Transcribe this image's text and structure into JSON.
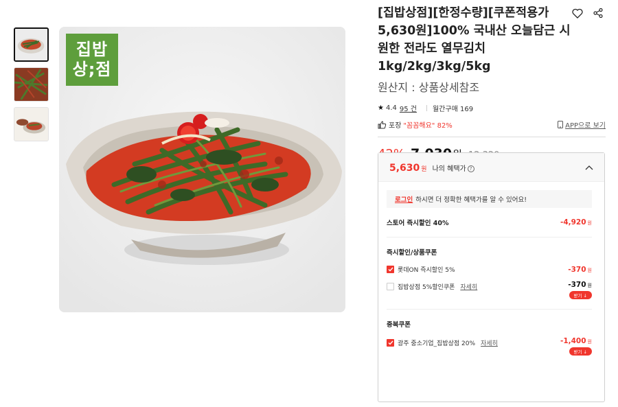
{
  "brand": {
    "logo_line1": "집밥",
    "logo_line2": "상;점",
    "color": "#5e9e3c"
  },
  "product": {
    "title": "[집밥상점][한정수량][쿠폰적용가 5,630원]100% 국내산 오늘담근 시원한 전라도 열무김치 1kg/2kg/3kg/5kg",
    "origin": "원산지 : 상품상세참조"
  },
  "icons": {
    "wishlist": "heart-icon",
    "share": "share-icon",
    "star": "star-icon",
    "thumbs": "thumbs-up-icon",
    "phone": "phone-icon"
  },
  "meta": {
    "rating": "4.4",
    "reviews": "95 건",
    "monthly": "월간구매 169"
  },
  "packaging": {
    "label": "포장",
    "quote": "\"꼼꼼해요\" 82%",
    "app_link": "APP으로 보기"
  },
  "price": {
    "discount": "42%",
    "sale": "7,030",
    "won": "원",
    "original": "12,320"
  },
  "benefit": {
    "price": "5,630",
    "won": "원",
    "label": "나의 혜택가",
    "login_link": "로그인",
    "login_text": "하시면 더 정확한 혜택가를 알 수 있어요!",
    "store_discount_label": "스토어 즉시할인 40%",
    "store_discount_amount": "-4,920",
    "section1_title": "즉시할인/상품쿠폰",
    "opt1_label": "롯데ON 즉시할인 5%",
    "opt1_amount": "-370",
    "opt2_label": "집밥상점 5%할인쿠폰",
    "opt2_detail": "자세히",
    "opt2_amount": "-370",
    "download": "받기 ↓",
    "section2_title": "중복쿠폰",
    "opt3_label": "광주 중소기업_집밥상점 20%",
    "opt3_detail": "자세히",
    "opt3_amount": "-1,400",
    "amount_won": "원"
  },
  "colors": {
    "accent": "#f0362d",
    "border": "#cfcfcf"
  }
}
